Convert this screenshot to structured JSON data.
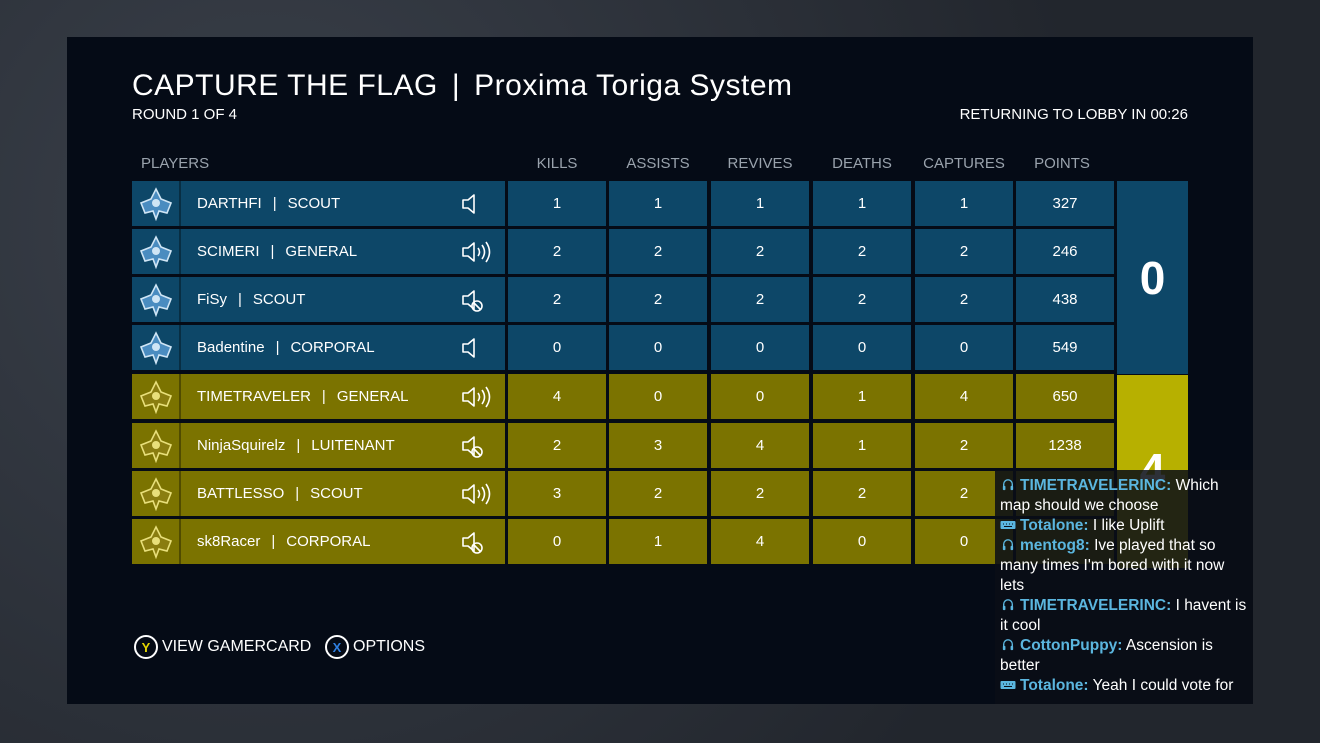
{
  "header": {
    "mode": "CAPTURE THE FLAG",
    "separator": "|",
    "map": "Proxima Toriga System",
    "round": "ROUND 1 OF 4",
    "countdown": "RETURNING TO LOBBY IN 00:26"
  },
  "columns": {
    "players": "PLAYERS",
    "kills": "KILLS",
    "assists": "ASSISTS",
    "revives": "REVIVES",
    "deaths": "DEATHS",
    "captures": "CAPTURES",
    "points": "POINTS"
  },
  "players": [
    {
      "name": "DARTHFI",
      "sep": "|",
      "rank": "SCOUT",
      "team": "blue",
      "voice": "speaker-icon",
      "kills": "1",
      "assists": "1",
      "revives": "1",
      "deaths": "1",
      "captures": "1",
      "points": "327"
    },
    {
      "name": "SCIMERI",
      "sep": "|",
      "rank": "GENERAL",
      "team": "blue",
      "voice": "speaker-talking-icon",
      "kills": "2",
      "assists": "2",
      "revives": "2",
      "deaths": "2",
      "captures": "2",
      "points": "246"
    },
    {
      "name": "FiSy",
      "sep": "|",
      "rank": "SCOUT",
      "team": "blue",
      "voice": "speaker-muted-icon",
      "kills": "2",
      "assists": "2",
      "revives": "2",
      "deaths": "2",
      "captures": "2",
      "points": "438"
    },
    {
      "name": "Badentine",
      "sep": "|",
      "rank": "CORPORAL",
      "team": "blue",
      "voice": "speaker-icon",
      "kills": "0",
      "assists": "0",
      "revives": "0",
      "deaths": "0",
      "captures": "0",
      "points": "549"
    },
    {
      "name": "TIMETRAVELER",
      "sep": "|",
      "rank": "GENERAL",
      "team": "gold",
      "voice": "speaker-talking-icon",
      "kills": "4",
      "assists": "0",
      "revives": "0",
      "deaths": "1",
      "captures": "4",
      "points": "650"
    },
    {
      "name": "NinjaSquirelz",
      "sep": "|",
      "rank": "LUITENANT",
      "team": "gold",
      "voice": "speaker-muted-icon",
      "kills": "2",
      "assists": "3",
      "revives": "4",
      "deaths": "1",
      "captures": "2",
      "points": "1238"
    },
    {
      "name": "BATTLESSO",
      "sep": "|",
      "rank": "SCOUT",
      "team": "gold",
      "voice": "speaker-talking-icon",
      "kills": "3",
      "assists": "2",
      "revives": "2",
      "deaths": "2",
      "captures": "2",
      "points": ""
    },
    {
      "name": "sk8Racer",
      "sep": "|",
      "rank": "CORPORAL",
      "team": "gold",
      "voice": "speaker-muted-icon",
      "kills": "0",
      "assists": "1",
      "revives": "4",
      "deaths": "0",
      "captures": "0",
      "points": ""
    }
  ],
  "team_scores": {
    "blue": "0",
    "gold": "4"
  },
  "footer": {
    "y_button": "Y",
    "y_label": "VIEW GAMERCARD",
    "x_button": "X",
    "x_label": "OPTIONS"
  },
  "chat": [
    {
      "icon": "headset-icon",
      "user": "TIMETRAVELERINC:",
      "text": "Which map should we choose"
    },
    {
      "icon": "keyboard-icon",
      "user": "Totalone:",
      "text": "I like Uplift"
    },
    {
      "icon": "headset-icon",
      "user": "mentog8:",
      "text": "Ive played that so many times I'm bored with it now lets"
    },
    {
      "icon": "headset-icon",
      "user": "TIMETRAVELERINC:",
      "text": "I havent is it cool"
    },
    {
      "icon": "headset-icon",
      "user": "CottonPuppy:",
      "text": "Ascension is better"
    },
    {
      "icon": "keyboard-icon",
      "user": "Totalone:",
      "text": "Yeah I could vote for"
    }
  ],
  "colors": {
    "team_blue": "#0d4768",
    "team_gold": "#7b7300",
    "gold_score": "#b7b000",
    "chat_name": "#5bb6df"
  }
}
